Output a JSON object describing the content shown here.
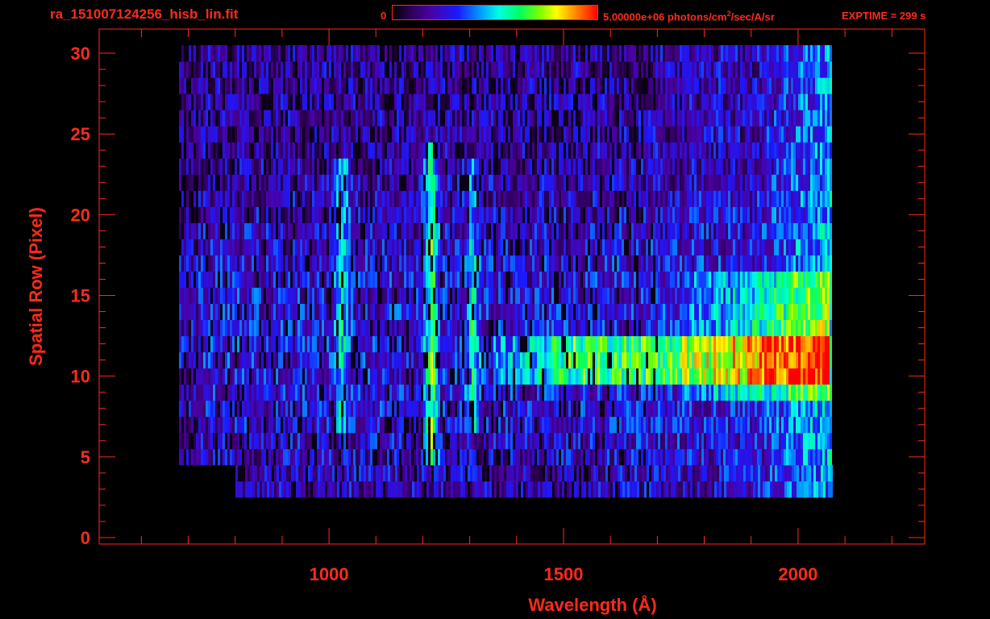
{
  "header": {
    "file_title": "ra_151007124256_hisb_lin.fit",
    "colorbar_min": "0",
    "colorbar_max_label": "5.00000e+06 photons/cm",
    "colorbar_max_sup": "2",
    "colorbar_max_suffix": "/sec/A/sr",
    "exptime": "EXPTIME = 299 s"
  },
  "colors": {
    "axis": "#ff2a1a",
    "background": "#000000"
  },
  "chart_data": {
    "type": "heatmap",
    "title": "ra_151007124256_hisb_lin.fit",
    "xlabel": "Wavelength (Å)",
    "ylabel": "Spatial Row (Pixel)",
    "xlim": [
      510,
      2270
    ],
    "ylim": [
      -0.4,
      31.5
    ],
    "xticks": [
      1000,
      1500,
      2000
    ],
    "yticks": [
      0,
      5,
      10,
      15,
      20,
      25,
      30
    ],
    "colorbar": {
      "min": 0,
      "max": 5000000,
      "units": "photons/cm^2/sec/A/sr",
      "colormap": "rainbow (black-purple-blue-cyan-green-yellow-red)"
    },
    "data_extent": {
      "x_start": 680,
      "x_end": 2070,
      "row_start": 3,
      "row_end": 30
    },
    "features": [
      {
        "wavelength": 1026,
        "rows": [
          7,
          23
        ],
        "level": "cyan"
      },
      {
        "wavelength": 1216,
        "rows": [
          5,
          24
        ],
        "level": "green-yellow"
      },
      {
        "wavelength": 1304,
        "rows": [
          7,
          23
        ],
        "level": "cyan"
      },
      {
        "wavelength_range": [
          1750,
          2065
        ],
        "rows": [
          9,
          16
        ],
        "level": "green-yellow"
      },
      {
        "wavelength_range": [
          1350,
          2065
        ],
        "rows": [
          10,
          12
        ],
        "level": "yellow-orange"
      }
    ]
  }
}
